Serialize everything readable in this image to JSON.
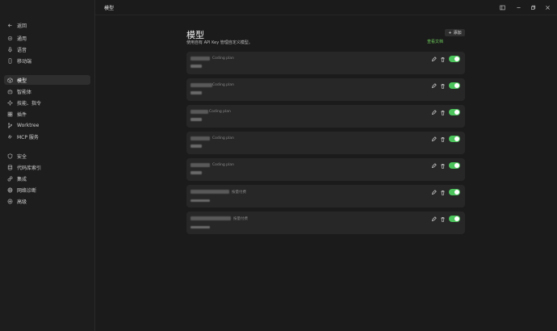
{
  "topbar": {
    "title": "模型"
  },
  "sidebar": {
    "back": "返回",
    "items": [
      {
        "label": "通用",
        "icon": "gear-icon"
      },
      {
        "label": "语音",
        "icon": "microphone-icon"
      },
      {
        "label": "移动端",
        "icon": "phone-icon"
      },
      {
        "label": "模型",
        "icon": "cube-icon",
        "active": true
      },
      {
        "label": "智能体",
        "icon": "bot-icon"
      },
      {
        "label": "技能、指令",
        "icon": "sparkle-icon"
      },
      {
        "label": "插件",
        "icon": "plugin-icon"
      },
      {
        "label": "Worktree",
        "icon": "branch-icon"
      },
      {
        "label": "MCP 服务",
        "icon": "mcp-icon"
      },
      {
        "label": "安全",
        "icon": "shield-icon"
      },
      {
        "label": "代码库索引",
        "icon": "database-icon"
      },
      {
        "label": "集成",
        "icon": "link-icon"
      },
      {
        "label": "网络诊断",
        "icon": "globe-icon"
      },
      {
        "label": "高级",
        "icon": "advanced-icon"
      }
    ]
  },
  "main": {
    "title": "模型",
    "description": "使用自有 API Key 管理自定义模型。",
    "add_label": "添加",
    "docs_label": "查看文档",
    "models": [
      {
        "tag": "Coding plan",
        "enabled": true
      },
      {
        "tag": "Coding plan",
        "enabled": true
      },
      {
        "tag": "Coding plan",
        "enabled": true
      },
      {
        "tag": "Coding plan",
        "enabled": true
      },
      {
        "tag": "Coding plan",
        "enabled": true
      },
      {
        "tag": "按量付费",
        "enabled": true
      },
      {
        "tag": "按量付费",
        "enabled": true
      }
    ]
  },
  "colors": {
    "accent": "#4cc45c",
    "link": "#6fcf5c",
    "background": "#1b1b1b",
    "card": "#272727"
  }
}
